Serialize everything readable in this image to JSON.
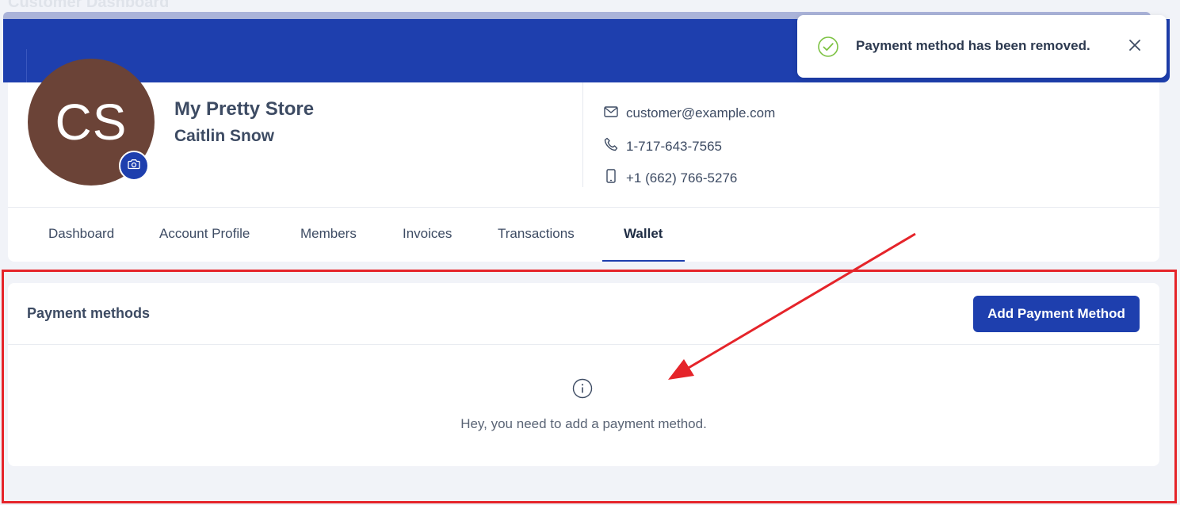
{
  "page": {
    "title": "Customer Dashboard"
  },
  "profile": {
    "initials": "CS",
    "avatar_color": "#6b4337",
    "store_name": "My Pretty Store",
    "person_name": "Caitlin Snow",
    "email": "customer@example.com",
    "phone": "1-717-643-7565",
    "mobile": "+1 (662) 766-5276"
  },
  "tabs": [
    {
      "label": "Dashboard",
      "active": false
    },
    {
      "label": "Account Profile",
      "active": false
    },
    {
      "label": "Members",
      "active": false
    },
    {
      "label": "Invoices",
      "active": false
    },
    {
      "label": "Transactions",
      "active": false
    },
    {
      "label": "Wallet",
      "active": true
    }
  ],
  "payment_methods": {
    "title": "Payment methods",
    "add_button_label": "Add Payment Method",
    "empty_message": "Hey, you need to add a payment method."
  },
  "toast": {
    "message": "Payment method has been removed.",
    "status": "success"
  },
  "colors": {
    "brand": "#1e3fae",
    "success": "#7cc242",
    "annotation": "#e5242a"
  }
}
